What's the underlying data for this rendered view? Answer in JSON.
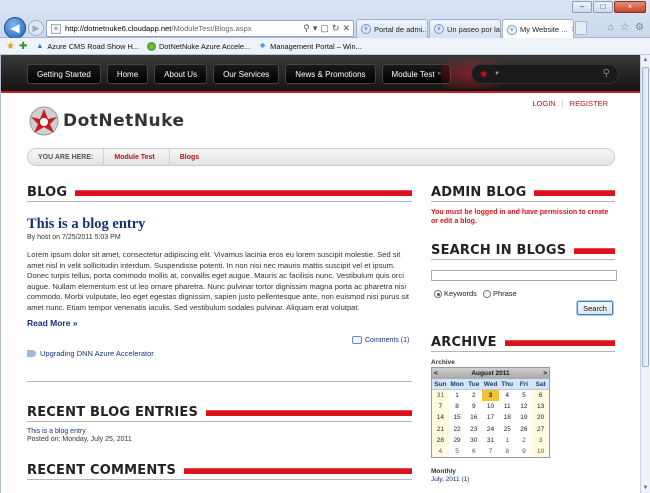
{
  "browser": {
    "url_host": "http://dotnetnuke6.cloudapp.net",
    "url_path": "/ModuleTest/Blogs.aspx",
    "tabs": [
      {
        "label": "Portal de admi..."
      },
      {
        "label": "Un paseo por la..."
      },
      {
        "label": "My Website ..."
      }
    ],
    "favorites": [
      {
        "label": "Azure CMS Road Show H..."
      },
      {
        "label": "DotNetNuke Azure Accele..."
      },
      {
        "label": "Management Portal – Win..."
      }
    ]
  },
  "nav": {
    "items": [
      {
        "label": "Getting Started"
      },
      {
        "label": "Home"
      },
      {
        "label": "About Us"
      },
      {
        "label": "Our Services"
      },
      {
        "label": "News & Promotions"
      },
      {
        "label": "Module Test"
      }
    ]
  },
  "header": {
    "login": "LOGIN",
    "register": "REGISTER",
    "logo_text_a": "DotNet",
    "logo_text_b": "Nuke"
  },
  "breadcrumb": {
    "label": "YOU ARE HERE:",
    "items": [
      "Module Test",
      "Blogs"
    ]
  },
  "blog": {
    "heading": "BLOG",
    "entry_title": "This is a blog entry",
    "entry_meta": "By host on 7/25/2011 5:03 PM",
    "entry_body": "Lorem ipsum dolor sit amet, consectetur adipiscing elit. Vivamus lacinia eros eu lorem suscipit molestie. Sed sit amet nisl in velit sollicitudin interdum. Suspendisse potenti. In non nisi nec mauris mattis suscipit vel et ipsum. Donec turpis tellus, porta commodo mollis at, convallis eget augue. Mauris ac facilisis nunc. Vestibulum quis orci augue. Nullam elementum est ut leo ornare pharetra. Nunc pulvinar tortor dignissim magna porta ac pharetra nisi commodo. Morbi vulputate, leo eget egestas dignissim, sapien justo pellentesque ante, non euismod nisi purus sit amet nunc. Etiam tempor venenatis iaculis. Sed vestibulum sodales pulvinar. Aliquam erat volutpat.",
    "read_more": "Read More »",
    "comments": "Comments (1)",
    "tag": "Upgrading DNN Azure Accelerator"
  },
  "recent_entries": {
    "heading": "RECENT BLOG ENTRIES",
    "link": "This is a blog entry",
    "posted": "Posted on: Monday, July 25, 2011"
  },
  "recent_comments": {
    "heading": "RECENT COMMENTS"
  },
  "admin_blog": {
    "heading": "ADMIN BLOG",
    "message": "You must be logged in and have permission to create or edit a blog."
  },
  "search_blogs": {
    "heading": "SEARCH IN BLOGS",
    "option_keywords": "Keywords",
    "option_phrase": "Phrase",
    "button": "Search"
  },
  "archive": {
    "heading": "ARCHIVE",
    "label": "Archive",
    "month": "August 2011",
    "prev": "<",
    "next": ">",
    "dow": [
      "Sun",
      "Mon",
      "Tue",
      "Wed",
      "Thu",
      "Fri",
      "Sat"
    ],
    "weeks": [
      [
        "31",
        "1",
        "2",
        "3",
        "4",
        "5",
        "6"
      ],
      [
        "7",
        "8",
        "9",
        "10",
        "11",
        "12",
        "13"
      ],
      [
        "14",
        "15",
        "16",
        "17",
        "18",
        "19",
        "20"
      ],
      [
        "21",
        "22",
        "23",
        "24",
        "25",
        "26",
        "27"
      ],
      [
        "28",
        "29",
        "30",
        "31",
        "1",
        "2",
        "3"
      ],
      [
        "4",
        "5",
        "6",
        "7",
        "8",
        "9",
        "10"
      ]
    ],
    "monthly_label": "Monthly",
    "monthly_link": "July, 2011 (1)"
  },
  "colors": {
    "accent_red": "#d9121c",
    "link_blue": "#14317a",
    "nav_bg": "#111111"
  }
}
